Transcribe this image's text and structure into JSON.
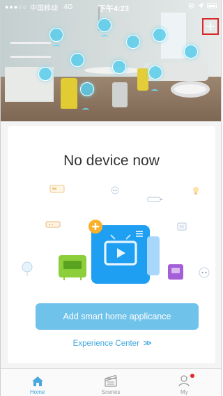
{
  "status_bar": {
    "signal": "●●●○○",
    "carrier": "中国移动",
    "network": "4G",
    "time": "下午4:23"
  },
  "header": {
    "add_button_label": "+"
  },
  "empty_state": {
    "title": "No device now",
    "add_button_label": "Add smart home applicance",
    "experience_link": "Experience Center",
    "experience_arrows": ">>"
  },
  "tabs": [
    {
      "label": "Home",
      "icon": "home-icon",
      "active": true
    },
    {
      "label": "Scenes",
      "icon": "scenes-icon",
      "active": false
    },
    {
      "label": "My",
      "icon": "user-icon",
      "active": false
    }
  ],
  "colors": {
    "accent": "#4aa7de",
    "button": "#6fc2ea",
    "badge": "#e8262a",
    "highlight_border": "#d8282c"
  }
}
